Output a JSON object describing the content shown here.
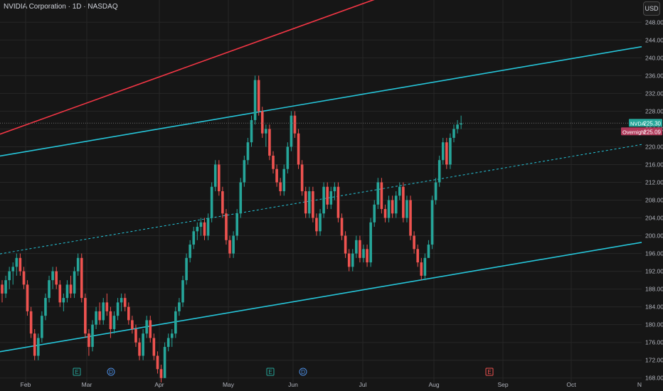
{
  "header": {
    "title": "NVIDIA Corporation · 1D · NASDAQ",
    "currency": "USD"
  },
  "price_labels": {
    "last": {
      "symbol": "NVDA",
      "value": "225.30"
    },
    "overnight": {
      "label": "Overnight",
      "value": "225.09"
    }
  },
  "colors": {
    "background": "#161616",
    "up": "#26a69a",
    "down": "#ef5350",
    "channel": "#26c6da",
    "upper_trend": "#f23645",
    "grid": "#262626",
    "text": "#b2b5be",
    "last_label_bg": "#26a69a",
    "overnight_label_bg": "#b03a5b"
  },
  "events": [
    {
      "type": "E",
      "date": "Mar 6",
      "color": "#26a69a"
    },
    {
      "type": "D",
      "date": "Mar 11",
      "color": "#4c8ce0"
    },
    {
      "type": "E",
      "date": "May 28",
      "color": "#26a69a"
    },
    {
      "type": "D",
      "date": "Jun 3",
      "color": "#4c8ce0"
    },
    {
      "type": "E",
      "date": "Aug 27",
      "color": "#ef5350"
    }
  ],
  "chart_data": {
    "type": "candlestick",
    "x_tick_labels": [
      "Feb",
      "Mar",
      "Apr",
      "May",
      "Jun",
      "Jul",
      "Aug",
      "Sep",
      "Oct",
      "N"
    ],
    "y_tick_labels": [
      "168.00",
      "172.00",
      "176.00",
      "180.00",
      "184.00",
      "188.00",
      "192.00",
      "196.00",
      "200.00",
      "204.00",
      "208.00",
      "212.00",
      "216.00",
      "220.00",
      "224.00",
      "228.00",
      "232.00",
      "236.00",
      "240.00",
      "244.00",
      "248.00"
    ],
    "ylim": [
      167,
      253
    ],
    "last_price": 225.3,
    "overnight_price": 225.09,
    "grid": true,
    "ohlc": [
      [
        189,
        190,
        185,
        187
      ],
      [
        187,
        191,
        186,
        190
      ],
      [
        190,
        193,
        188,
        192
      ],
      [
        192,
        194,
        189,
        193
      ],
      [
        193,
        196,
        191,
        195
      ],
      [
        195,
        196,
        191,
        192
      ],
      [
        192,
        193,
        188,
        189
      ],
      [
        189,
        190,
        182,
        183
      ],
      [
        183,
        184,
        177,
        178
      ],
      [
        178,
        179,
        172,
        173
      ],
      [
        173,
        178,
        172,
        177
      ],
      [
        177,
        183,
        176,
        182
      ],
      [
        182,
        187,
        181,
        186
      ],
      [
        186,
        191,
        185,
        190
      ],
      [
        190,
        193,
        188,
        192
      ],
      [
        192,
        193,
        188,
        189
      ],
      [
        189,
        190,
        184,
        185
      ],
      [
        185,
        187,
        183,
        186
      ],
      [
        186,
        190,
        185,
        189
      ],
      [
        189,
        191,
        186,
        187
      ],
      [
        187,
        193,
        186,
        192
      ],
      [
        192,
        196,
        191,
        195
      ],
      [
        195,
        196,
        185,
        186
      ],
      [
        186,
        187,
        177,
        178
      ],
      [
        178,
        179,
        173,
        175
      ],
      [
        175,
        181,
        174,
        180
      ],
      [
        180,
        184,
        179,
        183
      ],
      [
        183,
        185,
        180,
        181
      ],
      [
        181,
        186,
        180,
        185
      ],
      [
        185,
        187,
        182,
        183
      ],
      [
        183,
        184,
        177,
        179
      ],
      [
        179,
        183,
        178,
        182
      ],
      [
        182,
        186,
        181,
        185
      ],
      [
        185,
        187,
        183,
        186
      ],
      [
        186,
        187,
        183,
        184
      ],
      [
        184,
        185,
        180,
        181
      ],
      [
        181,
        182,
        178,
        179
      ],
      [
        179,
        180,
        175,
        176
      ],
      [
        176,
        177,
        172,
        173
      ],
      [
        173,
        179,
        172,
        178
      ],
      [
        178,
        182,
        177,
        181
      ],
      [
        181,
        182,
        176,
        177
      ],
      [
        177,
        178,
        172,
        173
      ],
      [
        173,
        174,
        169,
        170
      ],
      [
        170,
        171,
        167,
        168
      ],
      [
        168,
        176,
        168,
        175
      ],
      [
        175,
        178,
        174,
        177
      ],
      [
        177,
        179,
        175,
        178
      ],
      [
        178,
        184,
        177,
        183
      ],
      [
        183,
        186,
        182,
        185
      ],
      [
        185,
        191,
        184,
        190
      ],
      [
        190,
        196,
        189,
        195
      ],
      [
        195,
        199,
        194,
        198
      ],
      [
        198,
        202,
        197,
        201
      ],
      [
        201,
        203,
        199,
        202
      ],
      [
        202,
        204,
        200,
        203
      ],
      [
        203,
        204,
        199,
        200
      ],
      [
        200,
        205,
        199,
        204
      ],
      [
        204,
        212,
        203,
        211
      ],
      [
        211,
        217,
        210,
        216
      ],
      [
        216,
        217,
        209,
        210
      ],
      [
        210,
        211,
        204,
        205
      ],
      [
        205,
        206,
        198,
        199
      ],
      [
        199,
        200,
        195,
        196
      ],
      [
        196,
        201,
        195,
        200
      ],
      [
        200,
        206,
        199,
        205
      ],
      [
        205,
        213,
        204,
        212
      ],
      [
        212,
        218,
        211,
        217
      ],
      [
        217,
        222,
        216,
        221
      ],
      [
        221,
        227,
        220,
        226
      ],
      [
        226,
        236,
        225,
        235
      ],
      [
        235,
        236,
        227,
        228
      ],
      [
        228,
        229,
        222,
        223
      ],
      [
        223,
        225,
        220,
        224
      ],
      [
        224,
        225,
        217,
        218
      ],
      [
        218,
        219,
        214,
        215
      ],
      [
        215,
        216,
        211,
        212
      ],
      [
        212,
        213,
        209,
        210
      ],
      [
        210,
        216,
        209,
        215
      ],
      [
        215,
        221,
        214,
        220
      ],
      [
        220,
        228,
        219,
        227
      ],
      [
        227,
        228,
        222,
        223
      ],
      [
        223,
        224,
        215,
        216
      ],
      [
        216,
        217,
        209,
        210
      ],
      [
        210,
        211,
        204,
        205
      ],
      [
        205,
        211,
        204,
        210
      ],
      [
        210,
        211,
        203,
        204
      ],
      [
        204,
        205,
        200,
        201
      ],
      [
        201,
        206,
        200,
        205
      ],
      [
        205,
        212,
        204,
        211
      ],
      [
        211,
        212,
        206,
        207
      ],
      [
        207,
        211,
        206,
        210
      ],
      [
        210,
        212,
        208,
        211
      ],
      [
        211,
        212,
        203,
        204
      ],
      [
        204,
        205,
        199,
        200
      ],
      [
        200,
        201,
        195,
        196
      ],
      [
        196,
        197,
        192,
        193
      ],
      [
        193,
        197,
        192,
        196
      ],
      [
        196,
        200,
        195,
        199
      ],
      [
        199,
        200,
        194,
        195
      ],
      [
        195,
        198,
        194,
        197
      ],
      [
        197,
        198,
        193,
        194
      ],
      [
        194,
        204,
        193,
        203
      ],
      [
        203,
        208,
        202,
        207
      ],
      [
        207,
        213,
        206,
        212
      ],
      [
        212,
        213,
        205,
        206
      ],
      [
        206,
        207,
        203,
        204
      ],
      [
        204,
        209,
        203,
        208
      ],
      [
        208,
        209,
        204,
        205
      ],
      [
        205,
        210,
        204,
        209
      ],
      [
        209,
        212,
        208,
        211
      ],
      [
        211,
        212,
        203,
        204
      ],
      [
        204,
        209,
        203,
        208
      ],
      [
        208,
        209,
        199,
        200
      ],
      [
        200,
        201,
        196,
        197
      ],
      [
        197,
        198,
        193,
        194
      ],
      [
        194,
        195,
        190,
        191
      ],
      [
        191,
        196,
        190,
        195
      ],
      [
        195,
        199,
        195,
        198
      ],
      [
        198,
        209,
        197,
        208
      ],
      [
        208,
        213,
        207,
        212
      ],
      [
        212,
        218,
        211,
        217
      ],
      [
        217,
        222,
        216,
        221
      ],
      [
        221,
        222,
        215,
        216
      ],
      [
        216,
        223,
        215,
        222
      ],
      [
        222,
        225,
        221,
        224
      ],
      [
        224,
        226,
        223,
        225
      ],
      [
        225,
        227,
        224,
        225.3
      ]
    ],
    "trend_lines": [
      {
        "name": "upper trend line",
        "color": "#f23645",
        "style": "solid",
        "points": [
          [
            0,
            223
          ],
          [
            130,
            261
          ]
        ]
      },
      {
        "name": "channel top",
        "color": "#26c6da",
        "style": "solid",
        "points": [
          [
            0,
            218
          ],
          [
            130,
            236
          ]
        ]
      },
      {
        "name": "channel middle",
        "color": "#26c6da",
        "style": "dashed",
        "points": [
          [
            0,
            196
          ],
          [
            130,
            214
          ]
        ]
      },
      {
        "name": "channel bottom",
        "color": "#26c6da",
        "style": "solid",
        "points": [
          [
            0,
            174
          ],
          [
            130,
            192
          ]
        ]
      }
    ]
  }
}
